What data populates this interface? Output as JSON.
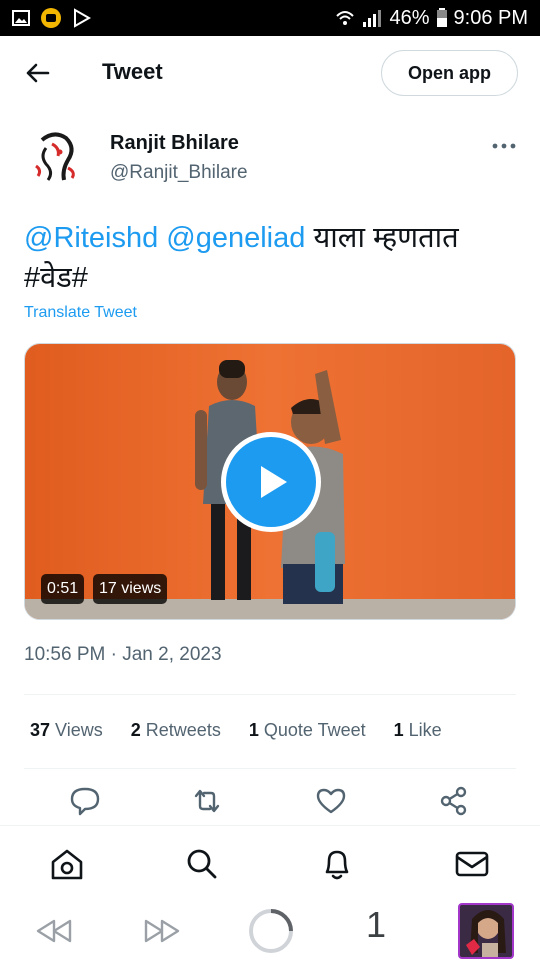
{
  "status_bar": {
    "battery": "46%",
    "time": "9:06 PM"
  },
  "header": {
    "title": "Tweet",
    "open_app": "Open app"
  },
  "author": {
    "name": "Ranjit Bhilare",
    "handle": "@Ranjit_Bhilare"
  },
  "tweet": {
    "mention1": "@Riteishd",
    "mention2": "@geneliad",
    "text_after": " याला म्हणतात",
    "line2": "#वेड#",
    "translate": "Translate Tweet"
  },
  "media": {
    "duration": "0:51",
    "views": "17 views"
  },
  "timestamp": "10:56 PM · Jan 2, 2023",
  "stats": [
    {
      "count": "37",
      "label": "Views"
    },
    {
      "count": "2",
      "label": "Retweets"
    },
    {
      "count": "1",
      "label": "Quote Tweet"
    },
    {
      "count": "1",
      "label": "Like"
    }
  ],
  "browser": {
    "tab_count": "1"
  },
  "colors": {
    "accent": "#1d9bf0",
    "secondary_text": "#536471",
    "video_wall": "#e8692a"
  }
}
